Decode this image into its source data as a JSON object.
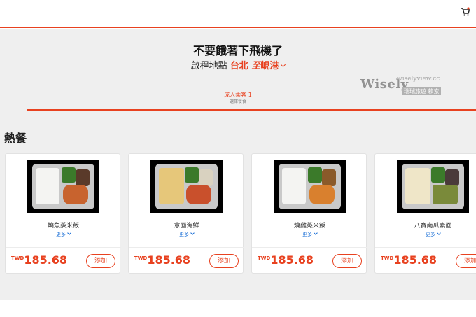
{
  "header": {
    "cart_icon": "shopping-cart-icon",
    "accent": "#e8411f"
  },
  "hero": {
    "title": "不要餓著下飛機了",
    "route_prefix": "啟程地點",
    "origin": "台北",
    "connector": "至",
    "destination": "峴港"
  },
  "watermark": {
    "name": "Wisely",
    "site": "wiselyview.cc",
    "tag": "瑞瑞旅遊 賴索"
  },
  "passenger": {
    "label": "成人乘客 1",
    "sub": "選擇餐食"
  },
  "section": {
    "title": "熱餐"
  },
  "meals": [
    {
      "name": "燒魚蒸米飯",
      "more": "更多",
      "currency": "TWD",
      "price": "185.68",
      "add": "添加"
    },
    {
      "name": "意面海鮮",
      "more": "更多",
      "currency": "TWD",
      "price": "185.68",
      "add": "添加"
    },
    {
      "name": "燒雞蒸米飯",
      "more": "更多",
      "currency": "TWD",
      "price": "185.68",
      "add": "添加"
    },
    {
      "name": "八寶南瓜素面",
      "more": "更多",
      "currency": "TWD",
      "price": "185.68",
      "add": "添加"
    }
  ]
}
